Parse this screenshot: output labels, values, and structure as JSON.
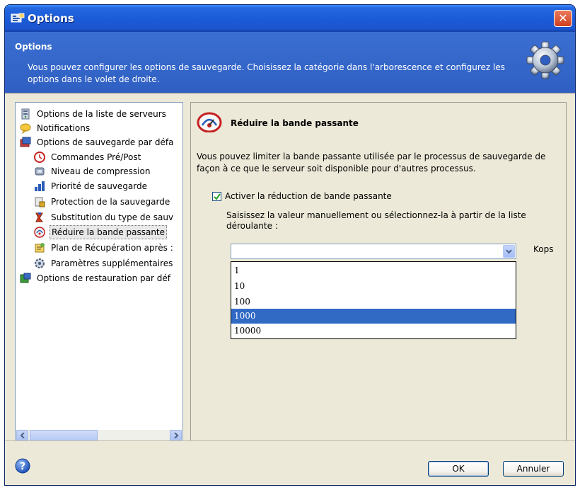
{
  "window": {
    "title": "Options",
    "close_glyph": "✕"
  },
  "header": {
    "title": "Options",
    "description": "Vous pouvez configurer les options de sauvegarde. Choisissez la catégorie dans l'arborescence et configurez les options dans le volet de droite."
  },
  "tree": {
    "items": [
      {
        "label": "Options de la liste de serveurs",
        "icon": "server-list-icon",
        "level": 0
      },
      {
        "label": "Notifications",
        "icon": "notification-icon",
        "level": 0
      },
      {
        "label": "Options de sauvegarde par défa",
        "icon": "backup-options-icon",
        "level": 0
      },
      {
        "label": "Commandes Pré/Post",
        "icon": "pre-post-commands-icon",
        "level": 1
      },
      {
        "label": "Niveau de compression",
        "icon": "compression-icon",
        "level": 1
      },
      {
        "label": "Priorité de sauvegarde",
        "icon": "priority-icon",
        "level": 1
      },
      {
        "label": "Protection de la sauvegarde",
        "icon": "protection-icon",
        "level": 1
      },
      {
        "label": "Substitution du type de sauv",
        "icon": "substitution-icon",
        "level": 1
      },
      {
        "label": "Réduire la bande passante",
        "icon": "bandwidth-icon",
        "level": 1,
        "selected": true
      },
      {
        "label": "Plan de Récupération après :",
        "icon": "recovery-plan-icon",
        "level": 1
      },
      {
        "label": "Paramètres supplémentaires",
        "icon": "additional-settings-icon",
        "level": 1
      },
      {
        "label": "Options de restauration par déf",
        "icon": "restore-options-icon",
        "level": 0
      }
    ]
  },
  "panel": {
    "title": "Réduire la bande passante",
    "description": "Vous pouvez limiter la bande passante utilisée par le processus de sauvegarde de façon à ce que le serveur soit disponible pour d'autres processus.",
    "checkbox_label": "Activer la réduction de bande passante",
    "checkbox_checked": true,
    "instruction": "Saisissez la valeur manuellement ou sélectionnez-la à partir de la liste déroulante :",
    "combo_value": "",
    "unit": "Kops",
    "options": [
      "1",
      "10",
      "100",
      "1000",
      "10000"
    ],
    "selected_option": "1000"
  },
  "footer": {
    "ok_label": "OK",
    "cancel_label": "Annuler"
  },
  "colors": {
    "titlebar": "#1b5bd8",
    "header": "#3366cc",
    "selection": "#316ac5",
    "dialog_bg": "#ece9d8"
  }
}
